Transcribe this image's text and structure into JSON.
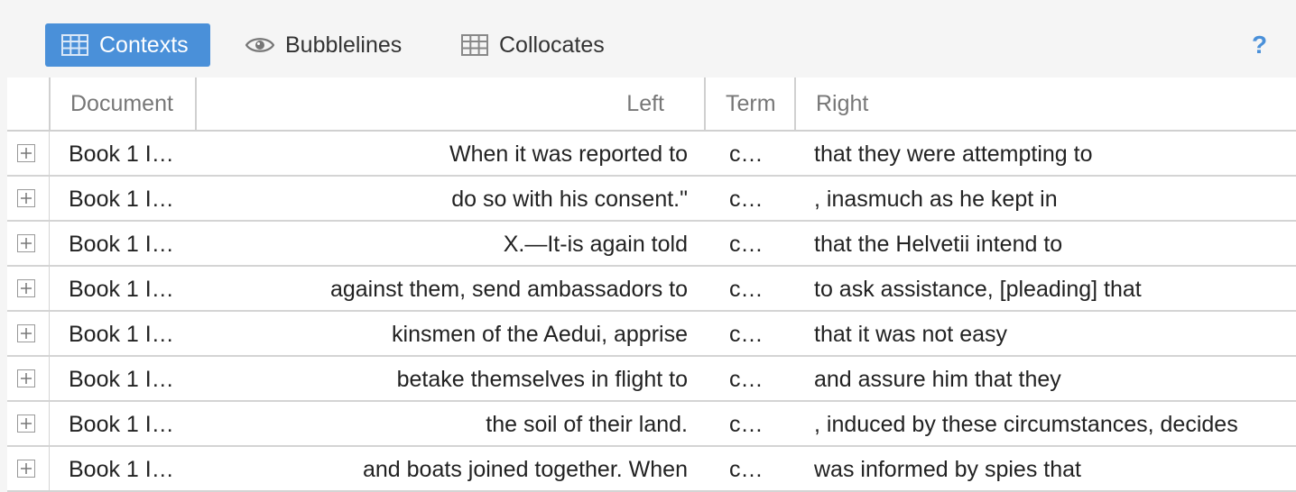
{
  "toolbar": {
    "tabs": [
      {
        "label": "Contexts",
        "icon": "table-icon",
        "active": true
      },
      {
        "label": "Bubblelines",
        "icon": "eye-icon",
        "active": false
      },
      {
        "label": "Collocates",
        "icon": "table-icon",
        "active": false
      }
    ],
    "help": "?"
  },
  "colors": {
    "accent": "#4a90d9",
    "header_text": "#777777",
    "border": "#d0d0d0"
  },
  "grid": {
    "columns": [
      "Document",
      "Left",
      "Term",
      "Right"
    ],
    "rows": [
      {
        "document": "Book 1 I…",
        "left": "When it was reported to",
        "term": "c…",
        "right": "that they were attempting to"
      },
      {
        "document": "Book 1 I…",
        "left": "do so with his consent.\"",
        "term": "c…",
        "right": ", inasmuch as he kept in"
      },
      {
        "document": "Book 1 I…",
        "left": "X.—It-is again told",
        "term": "c…",
        "right": "that the Helvetii intend to"
      },
      {
        "document": "Book 1 I…",
        "left": "against them, send ambassadors to",
        "term": "c…",
        "right": "to ask assistance, [pleading] that"
      },
      {
        "document": "Book 1 I…",
        "left": "kinsmen of the Aedui, apprise",
        "term": "c…",
        "right": "that it was not easy"
      },
      {
        "document": "Book 1 I…",
        "left": "betake themselves in flight to",
        "term": "c…",
        "right": "and assure him that they"
      },
      {
        "document": "Book 1 I…",
        "left": "the soil of their land.",
        "term": "c…",
        "right": ", induced by these circumstances, decides"
      },
      {
        "document": "Book 1 I…",
        "left": "and boats joined together. When",
        "term": "c…",
        "right": "was informed by spies that"
      }
    ]
  }
}
